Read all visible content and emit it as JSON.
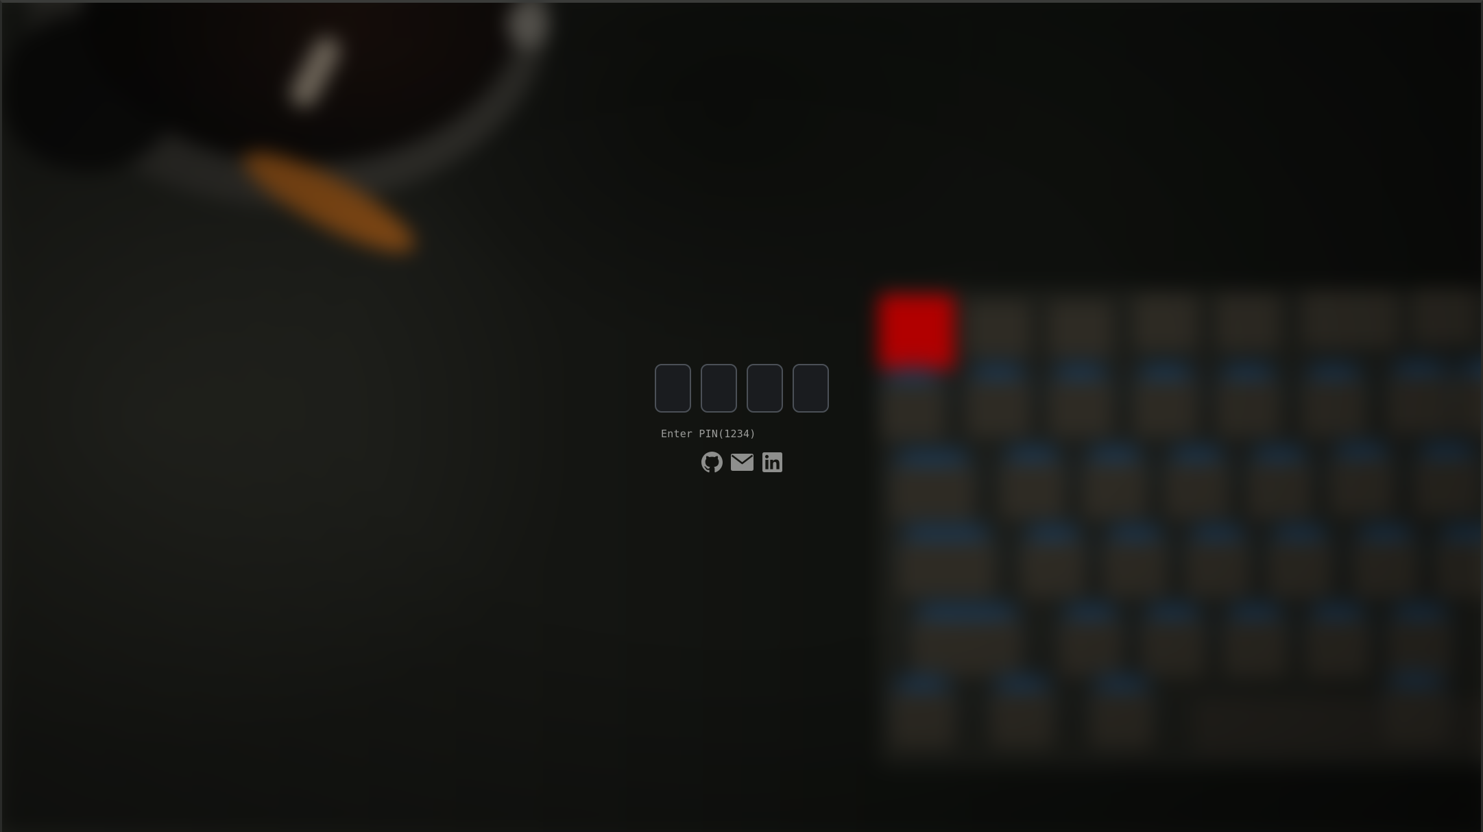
{
  "lock_screen": {
    "pin_hint": "Enter PIN(1234)",
    "pin_digits": [
      "",
      "",
      "",
      ""
    ],
    "pin_box_count": 4
  },
  "social_links": [
    {
      "name": "github",
      "icon": "github-icon"
    },
    {
      "name": "email",
      "icon": "mail-icon"
    },
    {
      "name": "linkedin",
      "icon": "linkedin-icon"
    }
  ],
  "colors": {
    "icon": "#8e8f8d",
    "pin_border": "#4b5057",
    "hint_text": "#9c9d9b",
    "accent_key": "#b10000"
  }
}
